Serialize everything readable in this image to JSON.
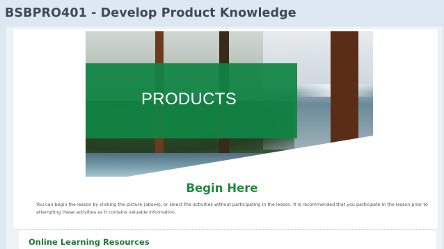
{
  "page": {
    "course_title": "BSBPRO401 - Develop Product Knowledge"
  },
  "hero": {
    "banner_text": "PRODUCTS"
  },
  "begin": {
    "label": "Begin Here",
    "instructions": "You can begin the lesson by clicking the picture (above), or select the activities without participating in the lesson. It is recommended that you participate in the lesson prior to attempting these activities as it contains valuable information."
  },
  "resources": {
    "title": "Online Learning Resources"
  },
  "colors": {
    "accent_green": "#1d8a3a",
    "banner_green": "#108444",
    "title_gray": "#3f4a54",
    "background": "#dde8f3"
  }
}
